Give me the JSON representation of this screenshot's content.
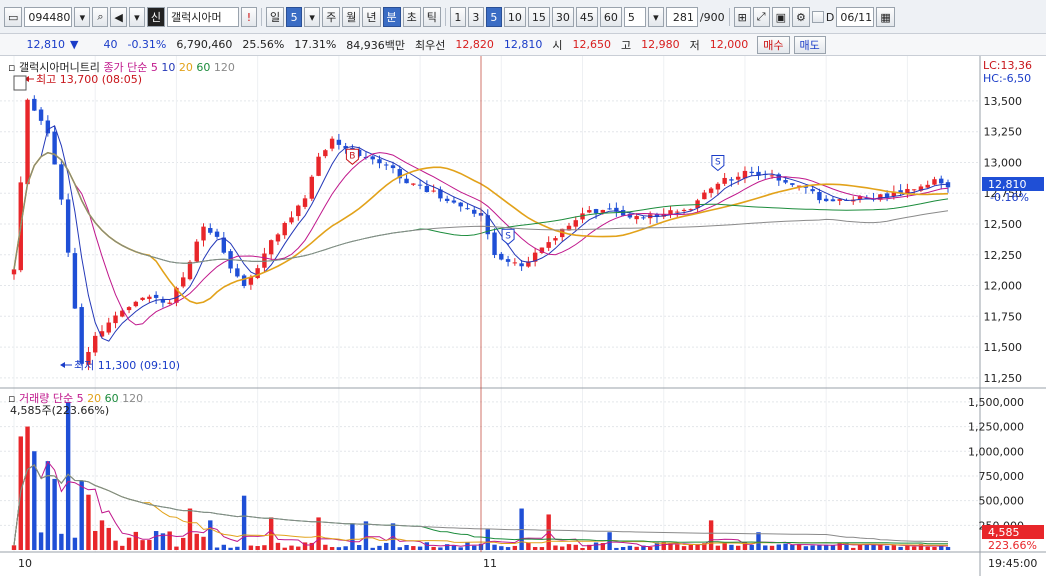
{
  "toolbar": {
    "code": "094480",
    "stock_badge": "신",
    "stock_name": "갤럭시아머",
    "period_buttons": [
      "일",
      "5",
      "주",
      "월",
      "년",
      "분",
      "초",
      "틱"
    ],
    "minute_buttons": [
      "1",
      "3",
      "5",
      "10",
      "15",
      "30",
      "45",
      "60"
    ],
    "count_select": "5",
    "count_current": "281",
    "count_total": "/900",
    "d_label": "D",
    "date": "06/11"
  },
  "quote": {
    "price": "12,810",
    "arrow": "▼",
    "change": "40",
    "change_pct": "-0.31%",
    "volume": "6,790,460",
    "rate1": "25.56%",
    "rate2": "17.31%",
    "amount": "84,936백만",
    "best_label": "최우선",
    "ask": "12,820",
    "bid": "12,810",
    "open_label": "시",
    "open": "12,650",
    "high_label": "고",
    "high": "12,980",
    "low_label": "저",
    "low": "12,000",
    "buy_label": "매수",
    "sell_label": "매도"
  },
  "price_panel": {
    "legend_name": "갤럭시아머니트리",
    "legend_ma": "종가 단순",
    "ma_periods": [
      "5",
      "10",
      "20",
      "60",
      "120"
    ],
    "high_annotation": "최고 13,700 (08:05)",
    "low_annotation": "최저 11,300 (09:10)",
    "lc_label": "LC:13,36",
    "hc_label": "HC:-6,50",
    "current_price": "12,810",
    "current_change": "-0.16%",
    "signals": [
      {
        "label": "B"
      },
      {
        "label": "S"
      },
      {
        "label": "S"
      }
    ]
  },
  "volume_panel": {
    "legend_name": "거래량",
    "legend_ma": "단순",
    "ma_periods": [
      "5",
      "20",
      "60",
      "120"
    ],
    "vol_readout": "4,585주(223.66%)",
    "current_volume": "4,585",
    "current_ratio": "223.66%"
  },
  "time_axis": {
    "labels": [
      "10",
      "11"
    ],
    "clock": "19:45:00"
  },
  "colors": {
    "up": "#e8262a",
    "down": "#1f4fd6",
    "ma5": "#2438b8",
    "ma10": "#c0188c",
    "ma20": "#e2a21a",
    "ma60": "#1c8c3c",
    "ma120": "#8a8a8a"
  },
  "chart_data": [
    {
      "type": "candlestick",
      "title": "",
      "ylim": [
        11200,
        13800
      ],
      "yticks": [
        11250,
        11500,
        11750,
        12000,
        12250,
        12500,
        12750,
        13000,
        13250,
        13500
      ],
      "ytick_labels": [
        "11,250",
        "11,500",
        "11,750",
        "12,000",
        "12,250",
        "12,500",
        "12,750",
        "13,000",
        "13,250",
        "13,500"
      ],
      "session_break_index": 69,
      "anchors": [
        [
          0,
          12150
        ],
        [
          2,
          13500
        ],
        [
          5,
          13250
        ],
        [
          7,
          12700
        ],
        [
          9,
          11800
        ],
        [
          10,
          11350
        ],
        [
          12,
          11600
        ],
        [
          15,
          11750
        ],
        [
          18,
          11880
        ],
        [
          21,
          11900
        ],
        [
          23,
          11850
        ],
        [
          26,
          12200
        ],
        [
          28,
          12500
        ],
        [
          30,
          12400
        ],
        [
          32,
          12150
        ],
        [
          34,
          12000
        ],
        [
          36,
          12150
        ],
        [
          38,
          12350
        ],
        [
          40,
          12500
        ],
        [
          43,
          12700
        ],
        [
          45,
          13050
        ],
        [
          47,
          13180
        ],
        [
          50,
          13080
        ],
        [
          52,
          13050
        ],
        [
          55,
          12980
        ],
        [
          58,
          12850
        ],
        [
          62,
          12750
        ],
        [
          66,
          12650
        ],
        [
          69,
          12550
        ],
        [
          71,
          12250
        ],
        [
          73,
          12200
        ],
        [
          75,
          12150
        ],
        [
          77,
          12250
        ],
        [
          80,
          12400
        ],
        [
          84,
          12600
        ],
        [
          88,
          12620
        ],
        [
          92,
          12560
        ],
        [
          96,
          12580
        ],
        [
          100,
          12640
        ],
        [
          104,
          12830
        ],
        [
          108,
          12920
        ],
        [
          112,
          12880
        ],
        [
          116,
          12820
        ],
        [
          120,
          12680
        ],
        [
          124,
          12700
        ],
        [
          128,
          12720
        ],
        [
          132,
          12770
        ],
        [
          136,
          12860
        ],
        [
          138,
          12810
        ]
      ],
      "count": 139,
      "series": [
        {
          "name": "5",
          "period": 5
        },
        {
          "name": "10",
          "period": 10
        },
        {
          "name": "20",
          "period": 20
        },
        {
          "name": "60",
          "period": 60
        },
        {
          "name": "120",
          "period": 120
        }
      ]
    },
    {
      "type": "bar",
      "title": "",
      "ylim": [
        0,
        1600000
      ],
      "yticks": [
        250000,
        500000,
        750000,
        1000000,
        1250000,
        1500000
      ],
      "ytick_labels": [
        "250,000",
        "500,000",
        "750,000",
        "1,000,000",
        "1,250,000",
        "1,500,000"
      ],
      "spikes": [
        [
          1,
          1150000
        ],
        [
          2,
          1250000
        ],
        [
          3,
          1000000
        ],
        [
          5,
          900000
        ],
        [
          6,
          720000
        ],
        [
          8,
          1500000
        ],
        [
          10,
          700000
        ],
        [
          11,
          560000
        ],
        [
          13,
          300000
        ],
        [
          26,
          420000
        ],
        [
          29,
          300000
        ],
        [
          34,
          550000
        ],
        [
          38,
          330000
        ],
        [
          45,
          330000
        ],
        [
          50,
          270000
        ],
        [
          52,
          290000
        ],
        [
          56,
          270000
        ],
        [
          70,
          210000
        ],
        [
          75,
          420000
        ],
        [
          79,
          360000
        ],
        [
          88,
          180000
        ],
        [
          103,
          300000
        ],
        [
          110,
          180000
        ]
      ],
      "series": [
        {
          "name": "5",
          "period": 5
        },
        {
          "name": "20",
          "period": 20
        },
        {
          "name": "60",
          "period": 60
        },
        {
          "name": "120",
          "period": 120
        }
      ]
    }
  ]
}
